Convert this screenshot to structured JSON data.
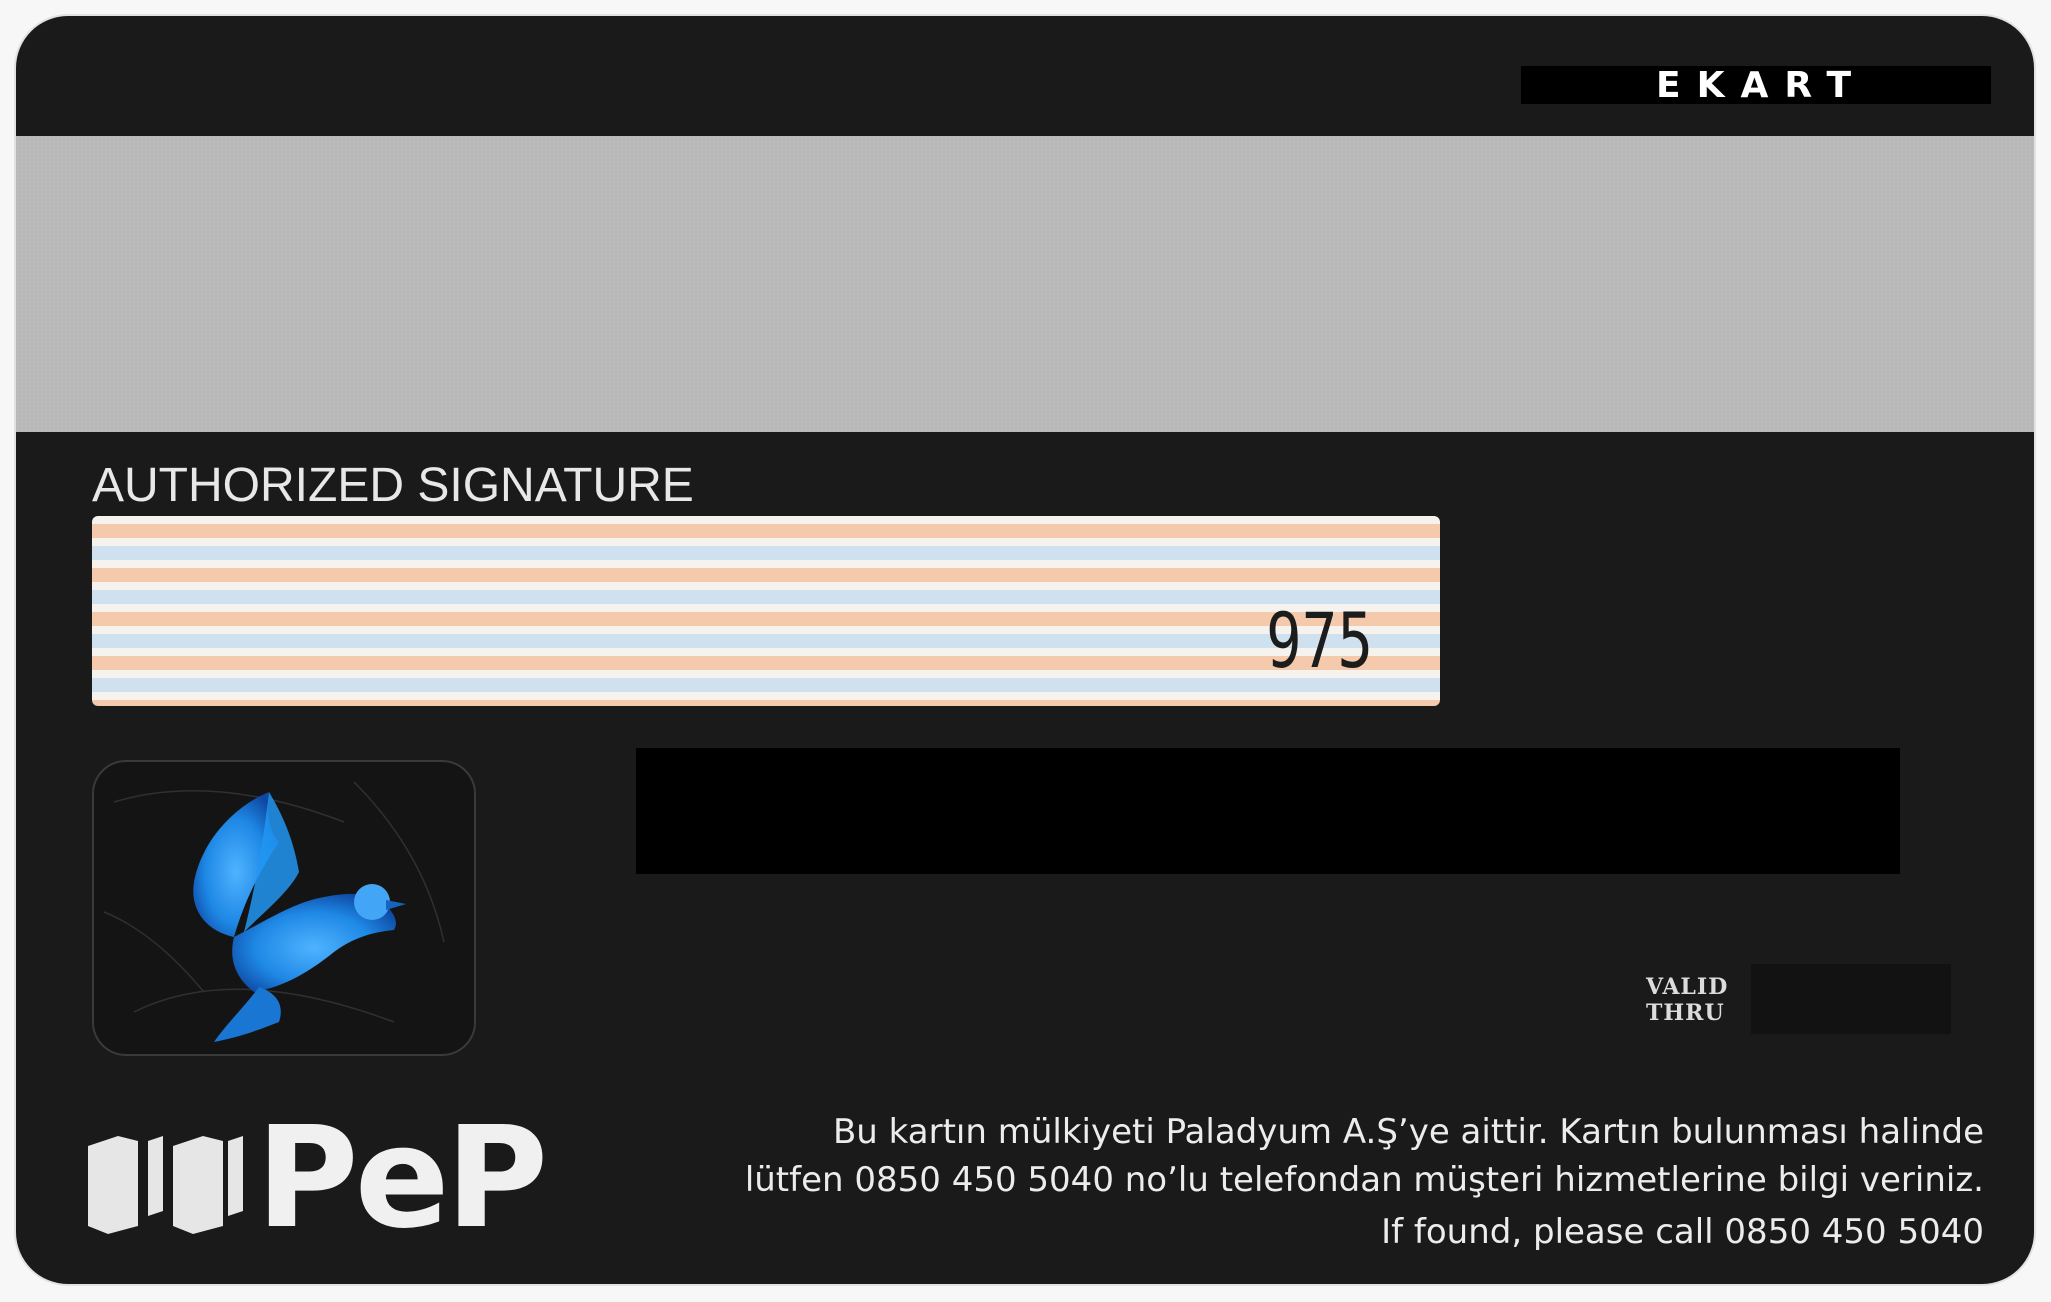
{
  "card": {
    "brand_top": "EKART",
    "signature_label": "AUTHORIZED SIGNATURE",
    "signature_code": "975",
    "valid_thru_line1": "VALID",
    "valid_thru_line2": "THRU",
    "logo_text": "PeP",
    "info_line1": "Bu kartın mülkiyeti Paladyum A.Ş’ye aittir. Kartın bulunması halinde",
    "info_line2": "lütfen 0850 450 5040 no’lu telefondan müşteri hizmetlerine bilgi veriniz.",
    "info_line3": "If found, please call 0850 450 5040"
  },
  "colors": {
    "card_body": "#1a1a1a",
    "magnetic_stripe": "#b9b9b9",
    "signature_orange": "#f4c9ac",
    "signature_blue": "#cfe0ee",
    "hologram_bird": "#1e88e5"
  },
  "icons": {
    "hologram": "dove-hologram-icon",
    "logo": "pep-logo-icon"
  }
}
